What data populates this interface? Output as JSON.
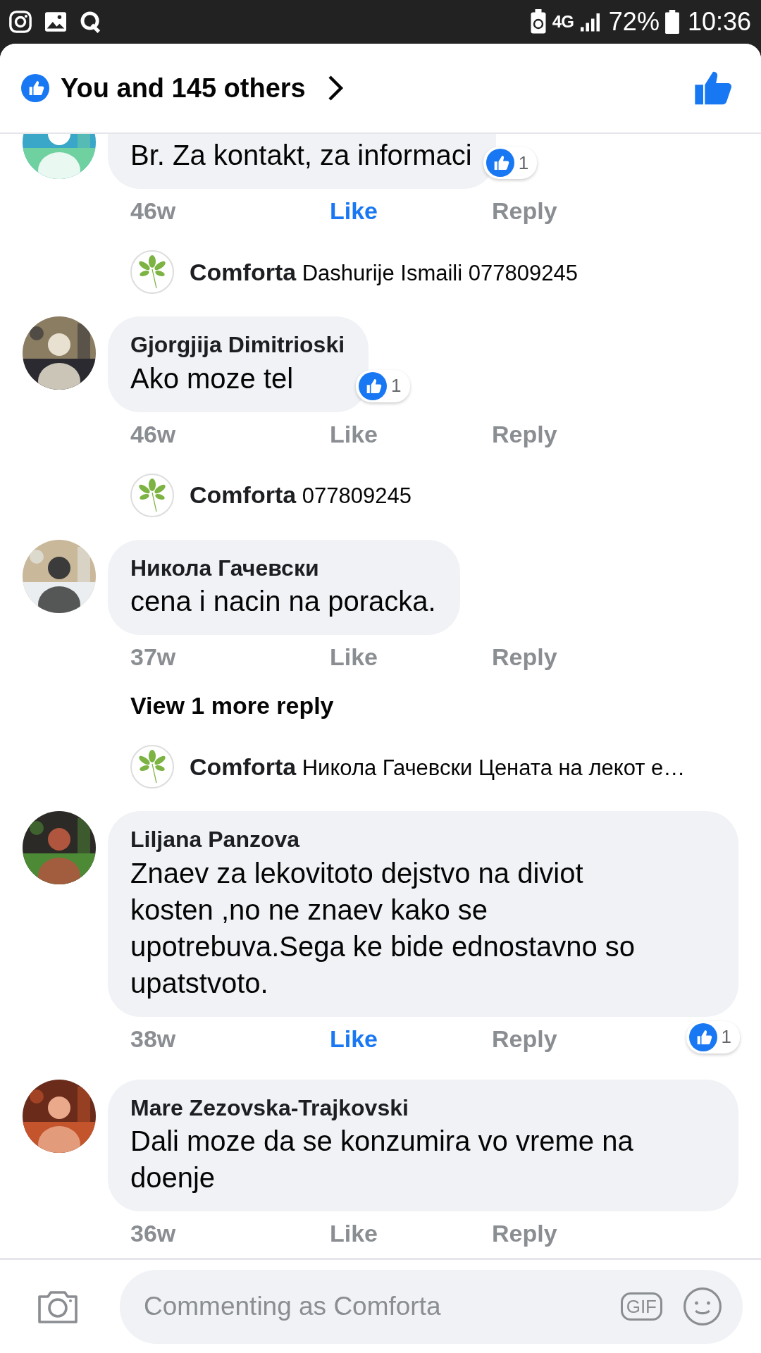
{
  "status_bar": {
    "network": "4G",
    "battery": "72%",
    "time": "10:36"
  },
  "header": {
    "title": "You and 145 others"
  },
  "items": [
    {
      "kind": "comment",
      "text": "Br. Za kontakt, za informaci",
      "time": "46w",
      "like_label": "Like",
      "reply_label": "Reply",
      "liked": true,
      "reaction_count": "1"
    },
    {
      "kind": "reply",
      "author": "Comforta",
      "text": "Dashurije Ismaili 077809245"
    },
    {
      "kind": "comment",
      "author": "Gjorgjija Dimitrioski",
      "text": "Ako moze tel",
      "time": "46w",
      "like_label": "Like",
      "reply_label": "Reply",
      "liked": false,
      "reaction_count": "1"
    },
    {
      "kind": "reply",
      "author": "Comforta",
      "text": "077809245"
    },
    {
      "kind": "comment",
      "author": "Никола Гачевски",
      "text": "cena i nacin na poracka.",
      "time": "37w",
      "like_label": "Like",
      "reply_label": "Reply",
      "liked": false
    },
    {
      "kind": "more",
      "label": "View 1 more reply"
    },
    {
      "kind": "reply",
      "author": "Comforta",
      "text": "Никола Гачевски Цената на лекот е…"
    },
    {
      "kind": "comment",
      "author": "Liljana Panzova",
      "text": "Znaev za lekovitoto dejstvo na diviot kosten ,no ne znaev kako se upotrebuva.Sega ke bide ednostavno so upatstvoto.",
      "time": "38w",
      "like_label": "Like",
      "reply_label": "Reply",
      "liked": true,
      "reaction_count": "1"
    },
    {
      "kind": "comment",
      "author": "Mare Zezovska-Trajkovski",
      "text": "Dali moze da se konzumira vo vreme na doenje",
      "time": "36w",
      "like_label": "Like",
      "reply_label": "Reply",
      "liked": false
    }
  ],
  "composer": {
    "placeholder": "Commenting as Comforta",
    "gif_label": "GIF"
  }
}
